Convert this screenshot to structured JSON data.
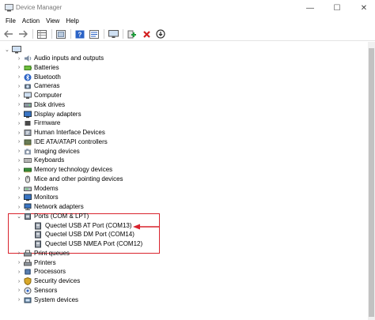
{
  "window": {
    "title": "Device Manager"
  },
  "controls": {
    "minimize": "—",
    "maximize": "☐",
    "close": "✕"
  },
  "menu": [
    "File",
    "Action",
    "View",
    "Help"
  ],
  "toolbar": {
    "icons": [
      "back-arrow-icon",
      "forward-arrow-icon",
      "properties-grid-icon",
      "show-hidden-icon",
      "help-icon",
      "scan-icon",
      "monitor-icon",
      "add-driver-icon",
      "uninstall-x-icon",
      "download-driver-icon"
    ]
  },
  "tree": {
    "root_label": "",
    "categories": [
      {
        "label": "Audio inputs and outputs",
        "icon": "speaker-icon",
        "expanded": false
      },
      {
        "label": "Batteries",
        "icon": "battery-icon",
        "expanded": false
      },
      {
        "label": "Bluetooth",
        "icon": "bluetooth-icon",
        "expanded": false
      },
      {
        "label": "Cameras",
        "icon": "camera-icon",
        "expanded": false
      },
      {
        "label": "Computer",
        "icon": "computer-icon",
        "expanded": false
      },
      {
        "label": "Disk drives",
        "icon": "disk-icon",
        "expanded": false
      },
      {
        "label": "Display adapters",
        "icon": "display-icon",
        "expanded": false
      },
      {
        "label": "Firmware",
        "icon": "chip-icon",
        "expanded": false
      },
      {
        "label": "Human Interface Devices",
        "icon": "hid-icon",
        "expanded": false
      },
      {
        "label": "IDE ATA/ATAPI controllers",
        "icon": "controller-icon",
        "expanded": false
      },
      {
        "label": "Imaging devices",
        "icon": "imaging-icon",
        "expanded": false
      },
      {
        "label": "Keyboards",
        "icon": "keyboard-icon",
        "expanded": false
      },
      {
        "label": "Memory technology devices",
        "icon": "memory-icon",
        "expanded": false
      },
      {
        "label": "Mice and other pointing devices",
        "icon": "mouse-icon",
        "expanded": false
      },
      {
        "label": "Modems",
        "icon": "modem-icon",
        "expanded": false
      },
      {
        "label": "Monitors",
        "icon": "monitor-icon",
        "expanded": false
      },
      {
        "label": "Network adapters",
        "icon": "network-icon",
        "expanded": false
      },
      {
        "label": "Ports (COM & LPT)",
        "icon": "port-icon",
        "expanded": true,
        "children": [
          "Quectel USB AT Port (COM13)",
          "Quectel USB DM Port (COM14)",
          "Quectel USB NMEA Port (COM12)"
        ]
      },
      {
        "label": "Print queues",
        "icon": "printer-icon",
        "expanded": false
      },
      {
        "label": "Printers",
        "icon": "printer-icon",
        "expanded": false
      },
      {
        "label": "Processors",
        "icon": "processor-icon",
        "expanded": false
      },
      {
        "label": "Security devices",
        "icon": "security-icon",
        "expanded": false
      },
      {
        "label": "Sensors",
        "icon": "sensor-icon",
        "expanded": false
      },
      {
        "label": "System devices",
        "icon": "system-icon",
        "expanded": false
      }
    ]
  },
  "colors": {
    "annotation": "#d9232d",
    "accent_blue": "#2b63c6"
  }
}
